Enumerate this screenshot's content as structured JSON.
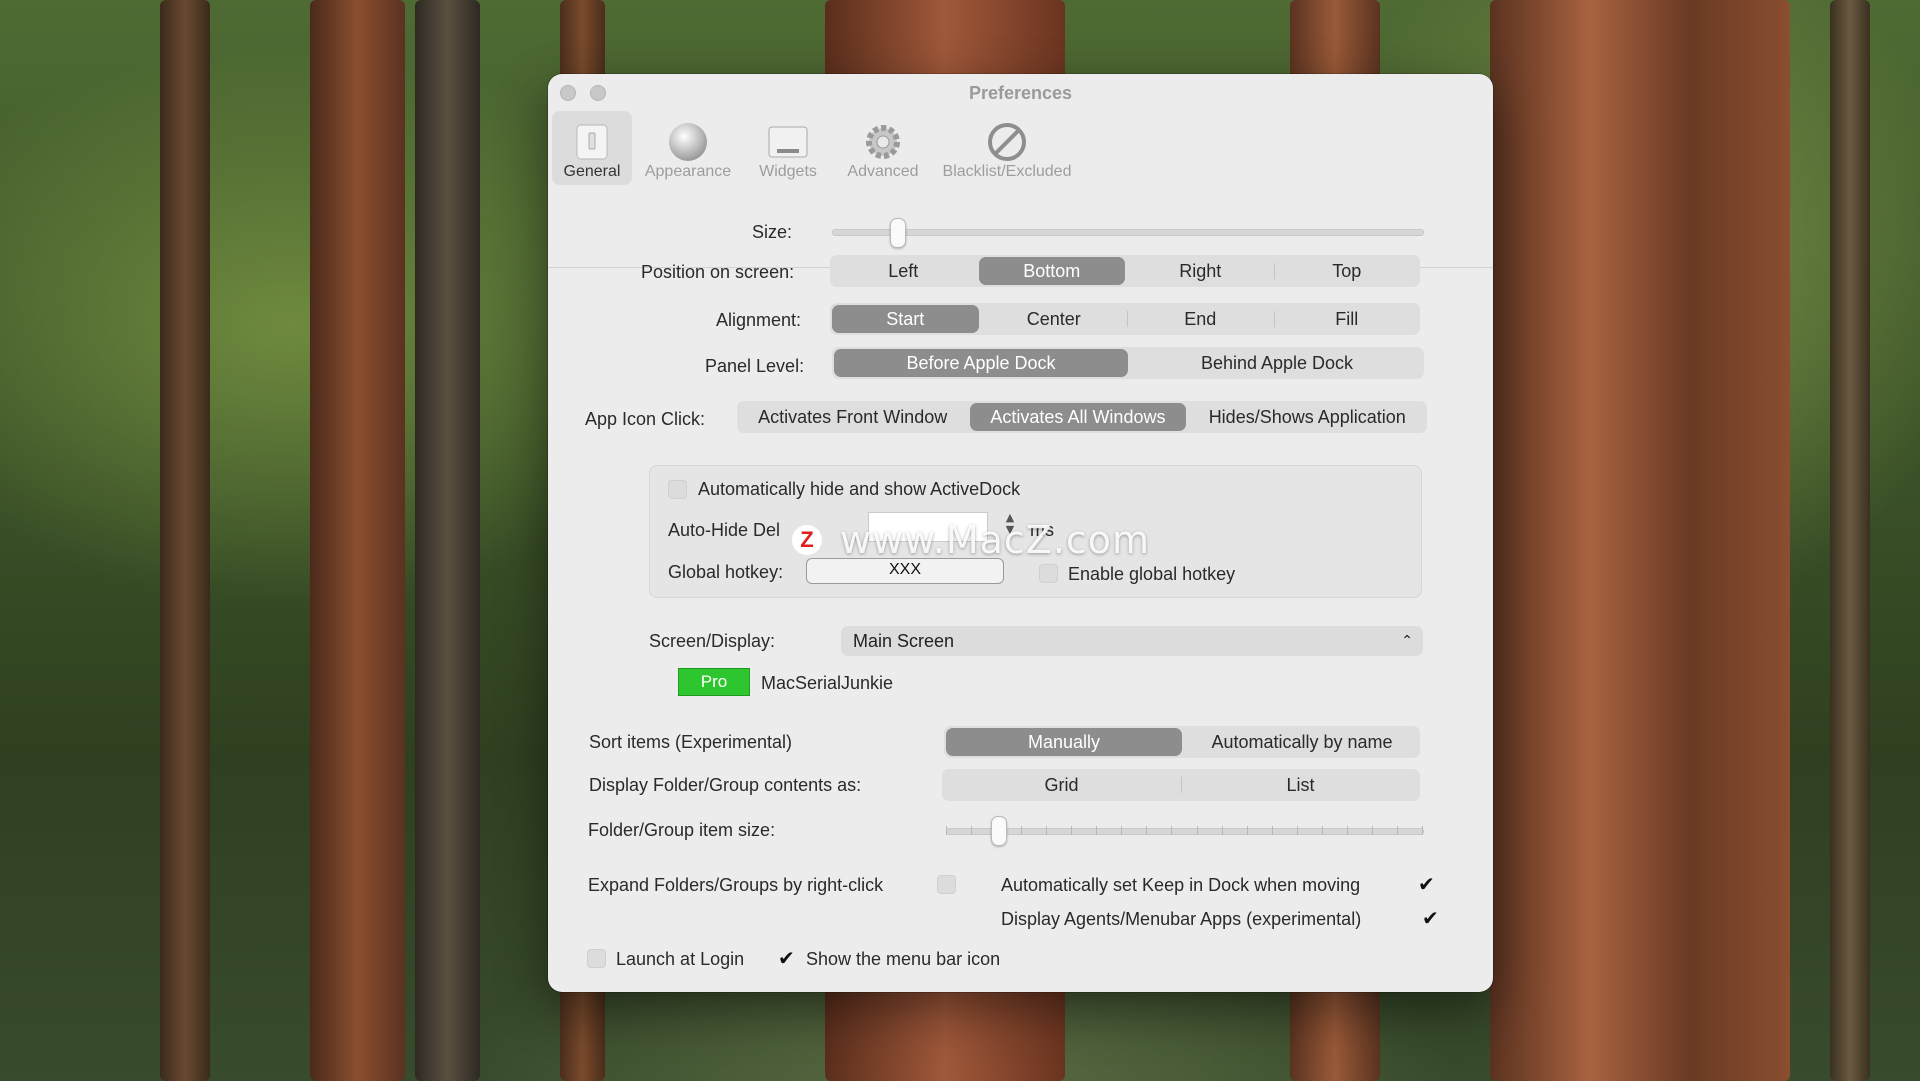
{
  "window": {
    "title": "Preferences"
  },
  "toolbar": {
    "items": [
      {
        "label": "General",
        "icon": "switch-icon",
        "selected": true
      },
      {
        "label": "Appearance",
        "icon": "sphere-icon",
        "selected": false
      },
      {
        "label": "Widgets",
        "icon": "widget-panel-icon",
        "selected": false
      },
      {
        "label": "Advanced",
        "icon": "gear-icon",
        "selected": false
      },
      {
        "label": "Blacklist/Excluded",
        "icon": "prohibited-icon",
        "selected": false
      }
    ]
  },
  "general": {
    "size": {
      "label": "Size:",
      "value_fraction": 0.11
    },
    "position": {
      "label": "Position on screen:",
      "options": [
        "Left",
        "Bottom",
        "Right",
        "Top"
      ],
      "selected": "Bottom"
    },
    "alignment": {
      "label": "Alignment:",
      "options": [
        "Start",
        "Center",
        "End",
        "Fill"
      ],
      "selected": "Start"
    },
    "panel_level": {
      "label": "Panel Level:",
      "options": [
        "Before Apple Dock",
        "Behind Apple Dock"
      ],
      "selected": "Before Apple Dock"
    },
    "app_icon_click": {
      "label": "App Icon Click:",
      "options": [
        "Activates Front Window",
        "Activates All Windows",
        "Hides/Shows Application"
      ],
      "selected": "Activates All Windows"
    },
    "autohide": {
      "checkbox_label": "Automatically hide and show ActiveDock",
      "checked": false,
      "delay_label": "Auto-Hide Del",
      "delay_value": "",
      "delay_unit": "ms"
    },
    "hotkey": {
      "label": "Global hotkey:",
      "value": "XXX",
      "enable_label": "Enable global hotkey",
      "enabled": false
    },
    "screen": {
      "label": "Screen/Display:",
      "selected": "Main Screen"
    },
    "license": {
      "badge": "Pro",
      "name": "MacSerialJunkie"
    },
    "sort": {
      "label": "Sort items (Experimental)",
      "options": [
        "Manually",
        "Automatically by name"
      ],
      "selected": "Manually"
    },
    "folder_display": {
      "label": "Display Folder/Group contents as:",
      "options": [
        "Grid",
        "List"
      ],
      "selected": ""
    },
    "folder_item_size": {
      "label": "Folder/Group item size:",
      "value_fraction": 0.11,
      "tick_count": 20
    },
    "expand_right_click": {
      "label": "Expand Folders/Groups by right-click",
      "checked": false
    },
    "keep_in_dock": {
      "label": "Automatically set Keep in Dock when moving",
      "checked": true
    },
    "display_agents": {
      "label": "Display Agents/Menubar Apps (experimental)",
      "checked": true
    },
    "launch_at_login": {
      "label": "Launch at Login",
      "checked": false
    },
    "menu_bar_icon": {
      "label": "Show the menu bar icon",
      "checked": true
    }
  },
  "watermark": {
    "text": "www.MacZ.com",
    "logo": "Z"
  },
  "colors": {
    "selected_segment": "#8d8d8d",
    "pro_badge": "#2ec62e",
    "window_bg": "#ececec"
  }
}
